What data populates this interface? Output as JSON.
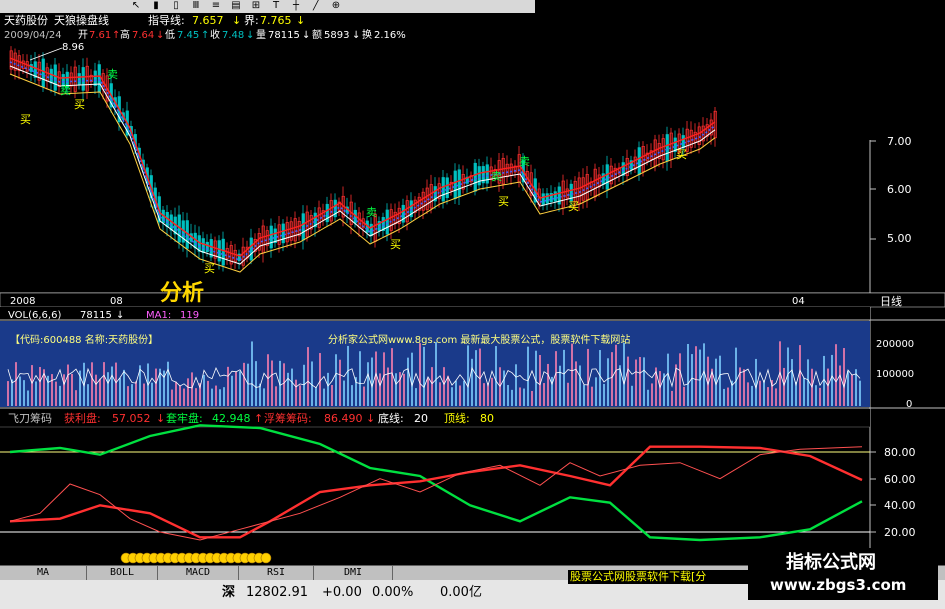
{
  "toolbar": {
    "icons": [
      "pointer-icon",
      "kline-icon",
      "bar-icon",
      "line-icon",
      "list-icon",
      "chart-icon",
      "grid-icon",
      "text-icon",
      "cursor-icon",
      "draw-icon",
      "zoom-icon"
    ]
  },
  "info": {
    "name": "天药股份",
    "indicator_name": "天狼操盘线",
    "guide_label": "指导线:",
    "guide_value": "7.657",
    "bound_label": "界:",
    "bound_value": "7.765",
    "date": "2009/04/24",
    "open_label": "开",
    "open_value": "7.61",
    "high_label": "高",
    "high_value": "7.64",
    "low_label": "低",
    "low_value": "7.45",
    "close_label": "收",
    "close_value": "7.48",
    "vol_label": "量",
    "vol_value": "78115",
    "amount_label": "额",
    "amount_value": "5893",
    "turnover_label": "换",
    "turnover_value": "2.16%",
    "peak": "8.96"
  },
  "price_axis": [
    "7.00",
    "6.00",
    "5.00"
  ],
  "markers": {
    "buy": "买",
    "sell": "卖"
  },
  "watermark": "分析",
  "time_axis": {
    "left_year": "2008",
    "label_08": "08",
    "label_04": "04",
    "period": "日线"
  },
  "volume": {
    "header_label": "VOL(6,6,6)",
    "header_value": "78115",
    "ma_label": "MA1:",
    "ma_value": "119",
    "banner_code": "【代码:600488  名称:天药股份】",
    "banner_site": "分析家公式网www.8gs.com  最新最大股票公式，股票软件下载网站",
    "axis": [
      "200000",
      "100000",
      "0"
    ]
  },
  "chip": {
    "title": "飞刀筹码",
    "profit_label": "获利盘:",
    "profit_value": "57.052",
    "trap_label": "套牢盘:",
    "trap_value": "42.948",
    "float_label": "浮筹筹码:",
    "float_value": "86.490",
    "bottom_label": "底线:",
    "bottom_value": "20",
    "top_label": "顶线:",
    "top_value": "80",
    "axis": [
      "80.00",
      "60.00",
      "40.00",
      "20.00"
    ]
  },
  "tabs": [
    "MA",
    "BOLL",
    "MACD",
    "RSI",
    "DMI"
  ],
  "status": {
    "market": "深",
    "index": "12802.91",
    "change": "+0.00",
    "pct": "0.00%",
    "amount": "0.00亿",
    "ticker": "股票公式网股票软件下载[分"
  },
  "brand": {
    "title": "指标公式网",
    "url": "www.zbgs3.com"
  },
  "colors": {
    "up": "#ff3030",
    "down": "#00c0c0",
    "yellow": "#ffff00",
    "green": "#00e040",
    "blue_bg": "#1a3a8a"
  }
}
